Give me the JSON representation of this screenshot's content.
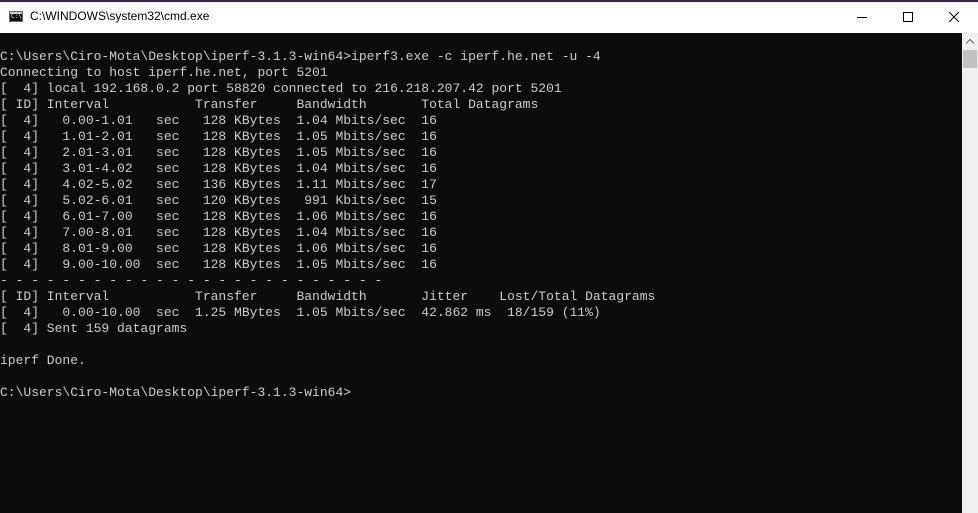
{
  "window": {
    "title": "C:\\WINDOWS\\system32\\cmd.exe",
    "icon": "cmd-icon",
    "icon_glyph": "C:\\",
    "controls": [
      "minimize-icon",
      "maximize-icon",
      "close-icon"
    ]
  },
  "colors": {
    "console_background": "#0c0c0c",
    "console_text": "#cccccc",
    "titlebar_background": "#ffffff"
  },
  "console": {
    "lines": [
      "",
      "C:\\Users\\Ciro-Mota\\Desktop\\iperf-3.1.3-win64>iperf3.exe -c iperf.he.net -u -4",
      "Connecting to host iperf.he.net, port 5201",
      "[  4] local 192.168.0.2 port 58820 connected to 216.218.207.42 port 5201",
      "[ ID] Interval           Transfer     Bandwidth       Total Datagrams",
      "[  4]   0.00-1.01   sec   128 KBytes  1.04 Mbits/sec  16",
      "[  4]   1.01-2.01   sec   128 KBytes  1.05 Mbits/sec  16",
      "[  4]   2.01-3.01   sec   128 KBytes  1.05 Mbits/sec  16",
      "[  4]   3.01-4.02   sec   128 KBytes  1.04 Mbits/sec  16",
      "[  4]   4.02-5.02   sec   136 KBytes  1.11 Mbits/sec  17",
      "[  4]   5.02-6.01   sec   120 KBytes   991 Kbits/sec  15",
      "[  4]   6.01-7.00   sec   128 KBytes  1.06 Mbits/sec  16",
      "[  4]   7.00-8.01   sec   128 KBytes  1.04 Mbits/sec  16",
      "[  4]   8.01-9.00   sec   128 KBytes  1.06 Mbits/sec  16",
      "[  4]   9.00-10.00  sec   128 KBytes  1.05 Mbits/sec  16",
      "- - - - - - - - - - - - - - - - - - - - - - - - -",
      "[ ID] Interval           Transfer     Bandwidth       Jitter    Lost/Total Datagrams",
      "[  4]   0.00-10.00  sec  1.25 MBytes  1.05 Mbits/sec  42.862 ms  18/159 (11%)",
      "[  4] Sent 159 datagrams",
      "",
      "iperf Done.",
      "",
      "C:\\Users\\Ciro-Mota\\Desktop\\iperf-3.1.3-win64>"
    ]
  },
  "scrollbar": {
    "icon": "scroll-up-arrow-icon"
  }
}
